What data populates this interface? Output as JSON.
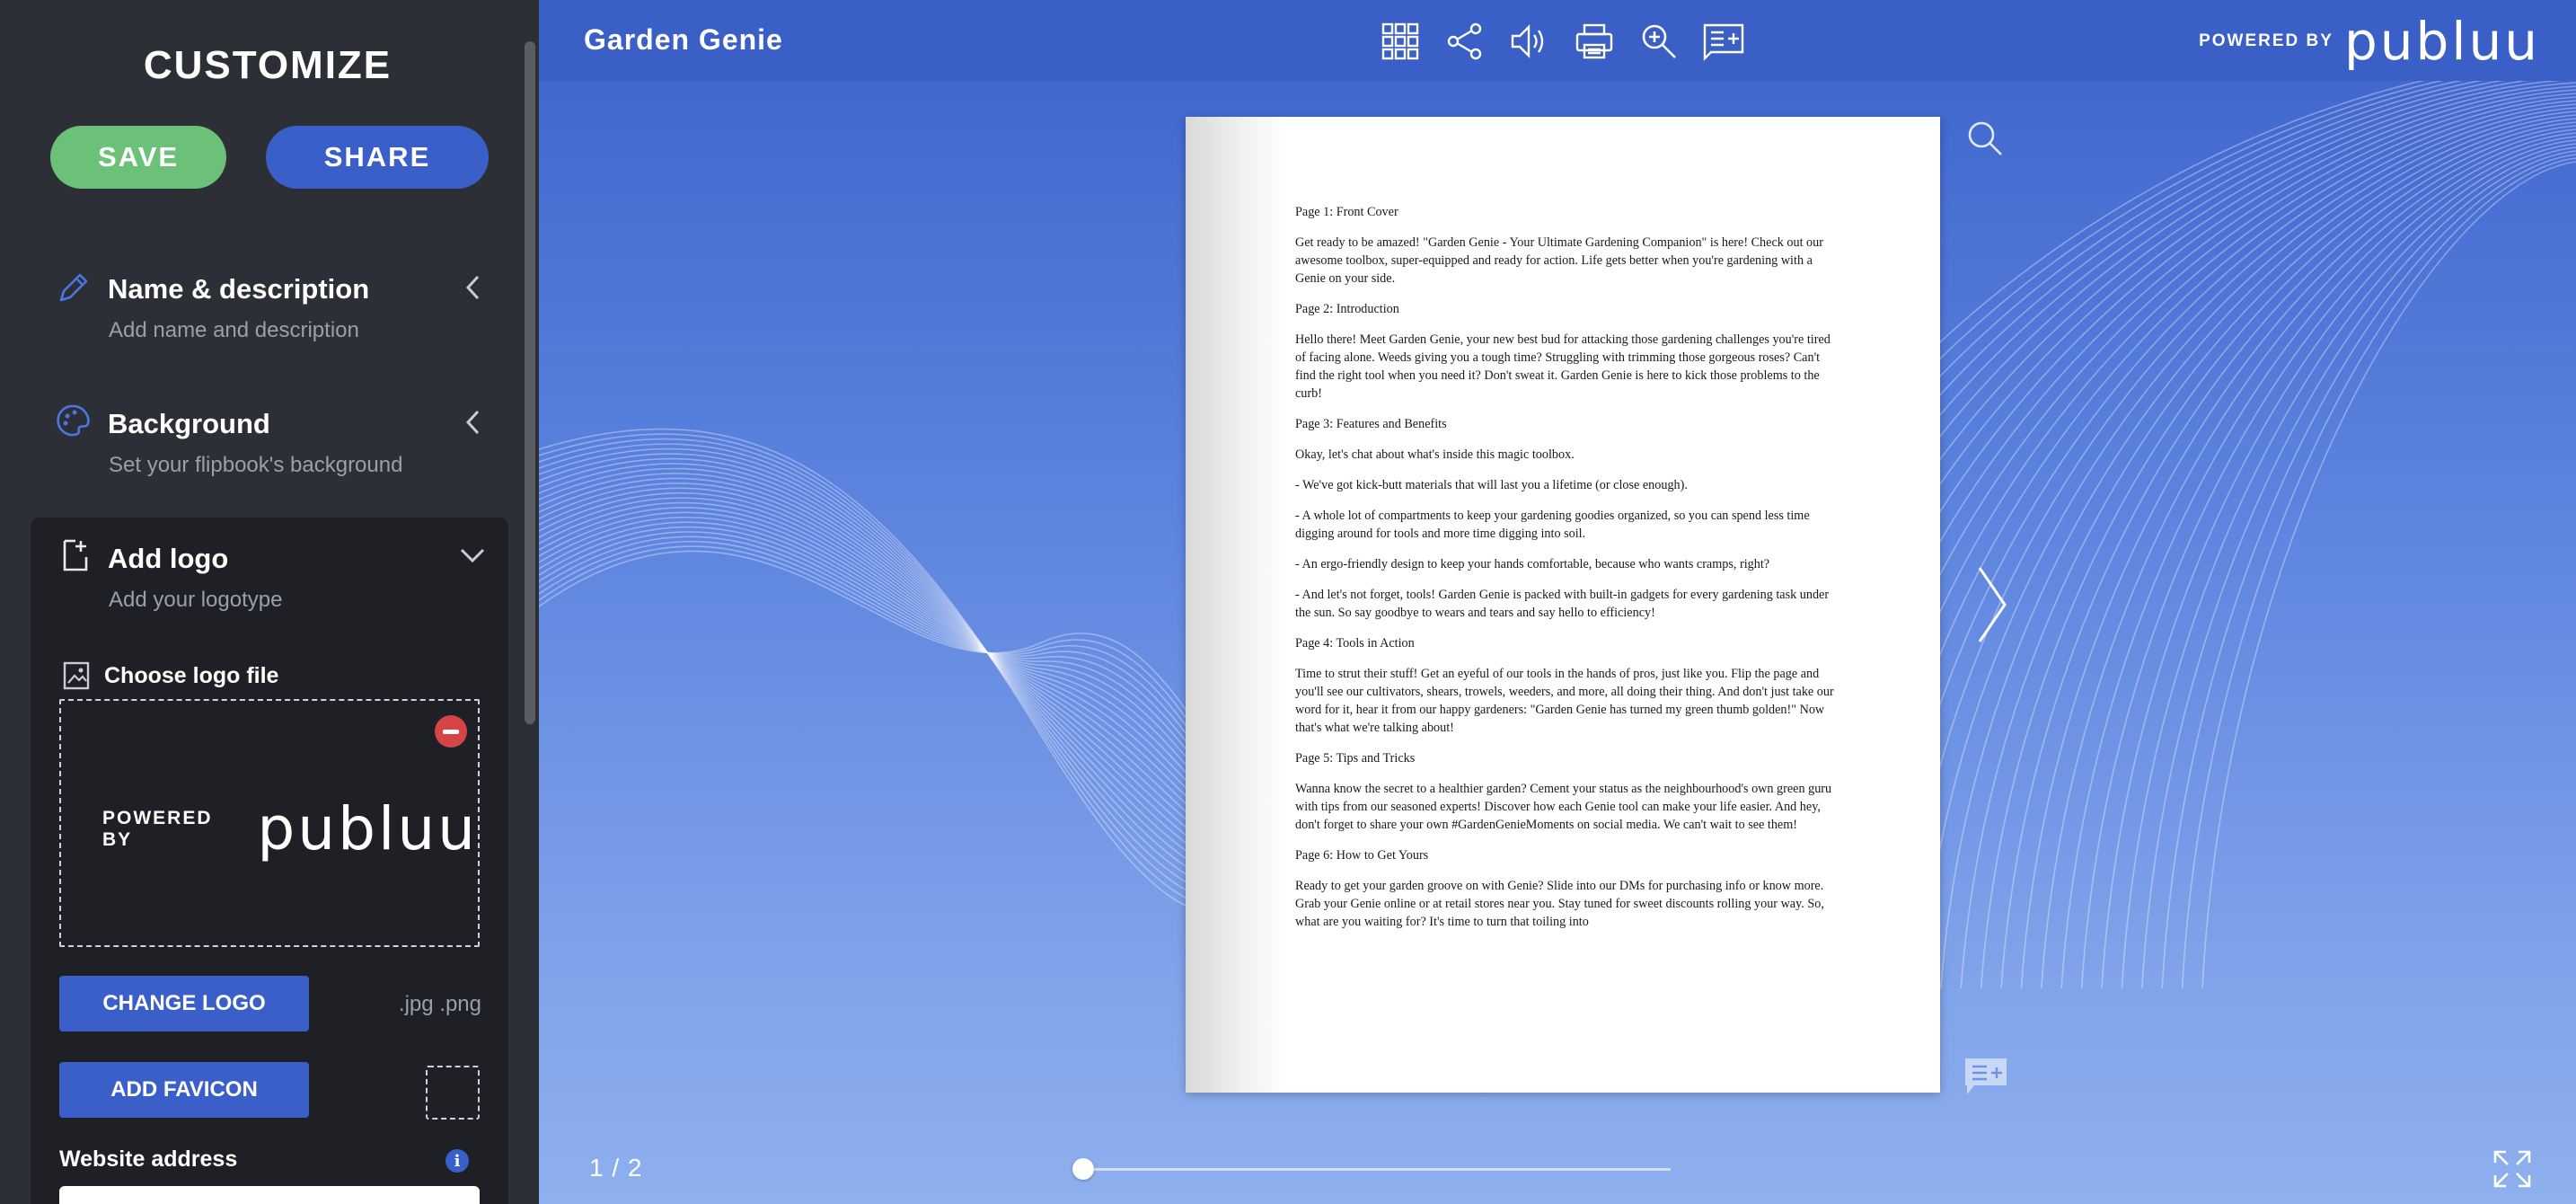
{
  "sidebar": {
    "title": "CUSTOMIZE",
    "save_label": "SAVE",
    "share_label": "SHARE",
    "sections": [
      {
        "title": "Name & description",
        "subtitle": "Add name and description",
        "icon": "pencil-icon"
      },
      {
        "title": "Background",
        "subtitle": "Set your flipbook's background",
        "icon": "palette-icon"
      },
      {
        "title": "Add logo",
        "subtitle": "Add your logotype",
        "icon": "document-add-icon"
      }
    ],
    "logo": {
      "choose_label": "Choose logo file",
      "preview_small": "POWERED BY",
      "preview_brand": "publuu",
      "change_label": "CHANGE LOGO",
      "extensions": ".jpg .png",
      "favicon_label": "ADD FAVICON",
      "website_label": "Website address",
      "website_value": ""
    }
  },
  "viewer": {
    "title": "Garden Genie",
    "tools": [
      "grid-icon",
      "share-icon",
      "speaker-icon",
      "print-icon",
      "zoom-in-icon",
      "notes-icon"
    ],
    "powered_small": "POWERED BY",
    "powered_brand": "publuu",
    "page_counter": "1  /  2",
    "progress": 0.0,
    "colors": {
      "topbar": "#3a5fc6",
      "accent": "#3b5fc9",
      "save": "#6cc178",
      "remove": "#d64545"
    }
  },
  "document": {
    "paragraphs": [
      "Page 1: Front Cover",
      "Get ready to be amazed! \"Garden Genie - Your Ultimate Gardening Companion\" is here! Check out our awesome toolbox, super-equipped and ready for action. Life gets better when you're gardening with a Genie on your side.",
      "Page 2: Introduction",
      "Hello there! Meet Garden Genie, your new best bud for attacking those gardening challenges you're tired of facing alone. Weeds giving you a tough time? Struggling with trimming those gorgeous roses? Can't find the right tool when you need it? Don't sweat it. Garden Genie is here to kick those problems to the curb!",
      "Page 3: Features and Benefits",
      "Okay, let's chat about what's inside this magic toolbox.",
      "- We've got kick-butt materials that will last you a lifetime (or close enough).",
      "- A whole lot of compartments to keep your gardening goodies organized, so you can spend less time digging around for tools and more time digging into soil.",
      "- An ergo-friendly design to keep your hands comfortable, because who wants cramps, right?",
      "- And let's not forget, tools! Garden Genie is packed with built-in gadgets for every gardening task under the sun. So say goodbye to wears and tears and say hello to efficiency!",
      "Page 4: Tools in Action",
      "Time to strut their stuff! Get an eyeful of our tools in the hands of pros, just like you. Flip the page and you'll see our cultivators, shears, trowels, weeders, and more, all doing their thing. And don't just take our word for it, hear it from our happy gardeners: \"Garden Genie has turned my green thumb golden!\" Now that's what we're talking about!",
      "Page 5: Tips and Tricks",
      "Wanna know the secret to a healthier garden? Cement your status as the neighbourhood's own green guru with tips from our seasoned experts! Discover how each Genie tool can make your life easier. And hey, don't forget to share your own #GardenGenieMoments on social media. We can't wait to see them!",
      "Page 6: How to Get Yours",
      "Ready to get your garden groove on with Genie? Slide into our DMs for purchasing info or know more. Grab your Genie online or at retail stores near you. Stay tuned for sweet discounts rolling your way. So, what are you waiting for? It's time to turn that toiling into"
    ]
  }
}
